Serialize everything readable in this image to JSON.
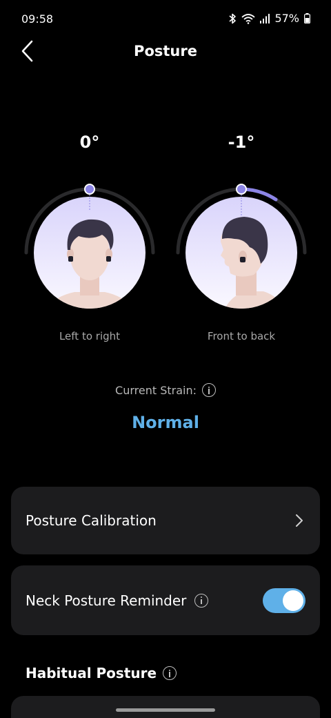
{
  "status_bar": {
    "time": "09:58",
    "battery": "57%"
  },
  "header": {
    "title": "Posture"
  },
  "gauges": [
    {
      "angle": "0°",
      "label": "Left to right"
    },
    {
      "angle": "-1°",
      "label": "Front to back"
    }
  ],
  "strain": {
    "label": "Current Strain:",
    "value": "Normal"
  },
  "cards": {
    "calibration": "Posture Calibration",
    "reminder": "Neck Posture Reminder",
    "reminder_enabled": true
  },
  "section": {
    "habitual_posture": "Habitual Posture"
  },
  "colors": {
    "accent": "#5fb0e8",
    "indicator": "#8c85e6",
    "card_bg": "#1c1c1e"
  }
}
